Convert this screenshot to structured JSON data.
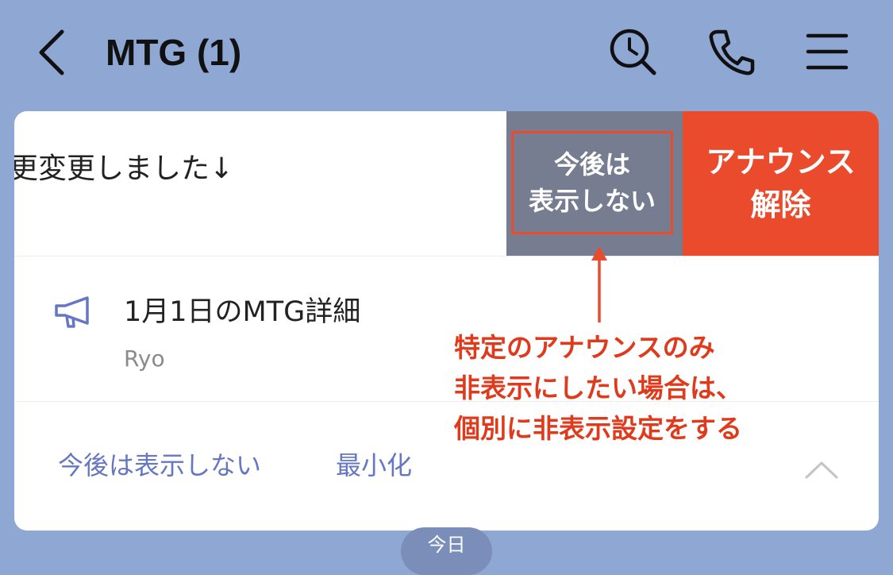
{
  "header": {
    "title": "MTG (1)",
    "icons": [
      "chevron-left-icon",
      "search-history-icon",
      "phone-icon",
      "menu-icon"
    ]
  },
  "announcement_swiped": {
    "text_partial": "更変更しました↓",
    "hide_action_label": "今後は\n表示しない",
    "unpin_action_label": "アナウンス\n解除"
  },
  "announcement": {
    "title": "1月1日のMTG詳細",
    "author": "Ryo"
  },
  "footer_actions": {
    "hide_link": "今後は表示しない",
    "minimize_link": "最小化"
  },
  "annotation": {
    "line1": "特定のアナウンスのみ",
    "line2": "非表示にしたい場合は、",
    "line3": "個別に非表示設定をする"
  },
  "date_pill": "今日",
  "colors": {
    "background": "#8fa7d3",
    "hide_action": "#777d90",
    "unpin_action": "#e94b2c",
    "link": "#6577c4",
    "annotation": "#e03a1c"
  }
}
